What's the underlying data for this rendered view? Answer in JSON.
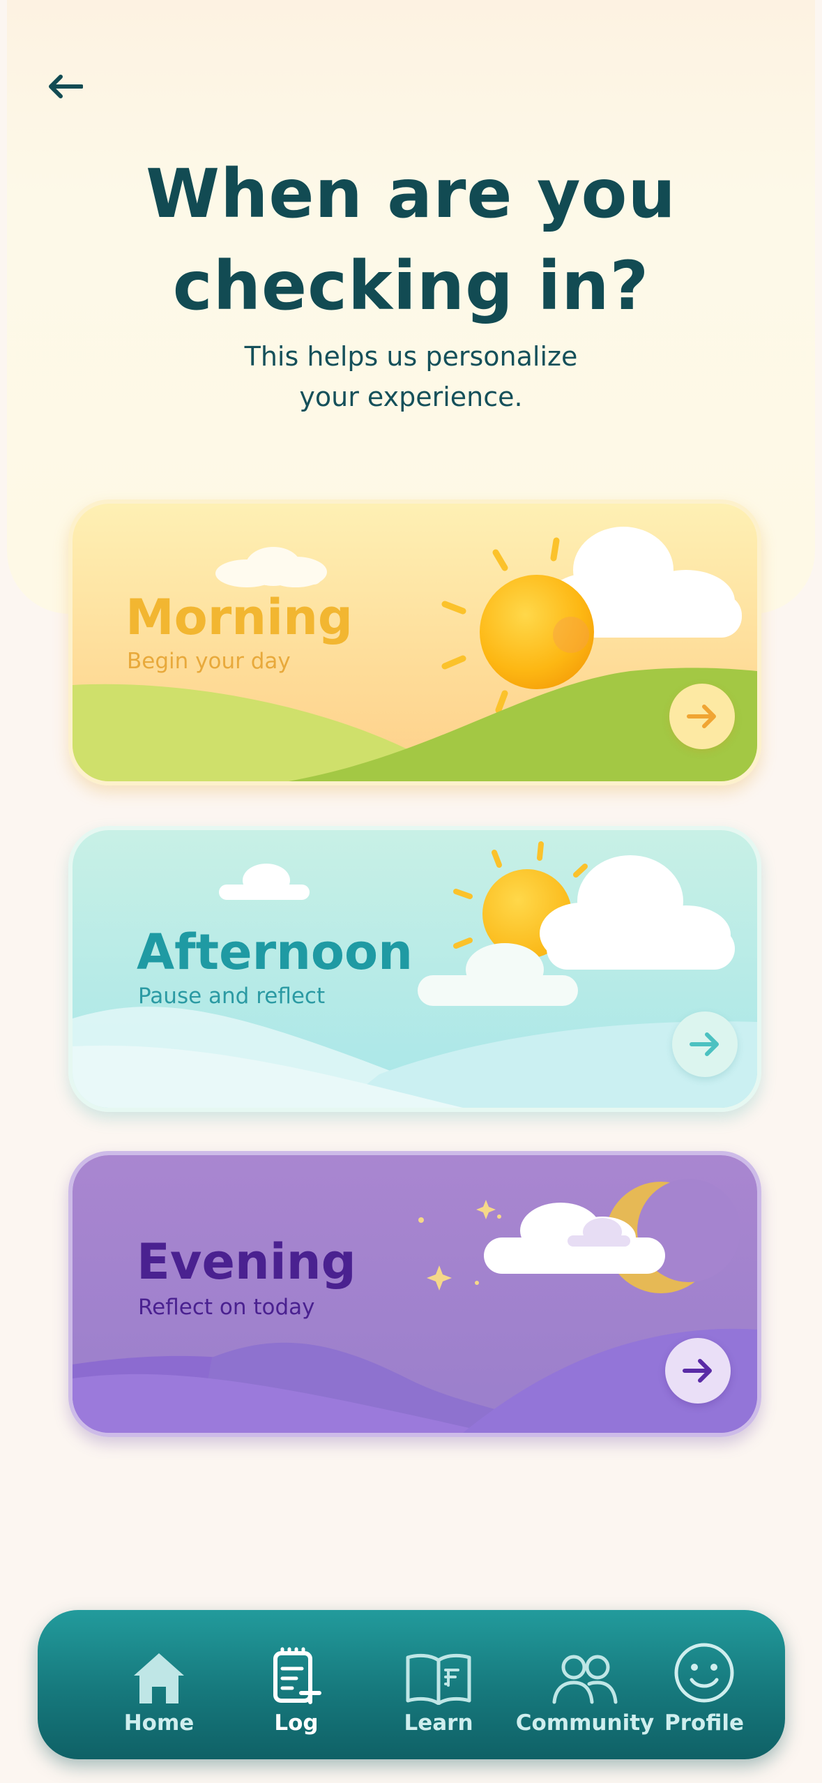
{
  "header": {
    "title_line1": "When are you",
    "title_line2": "checking in?",
    "subtitle_line1": "This helps us personalize",
    "subtitle_line2": "your experience."
  },
  "cards": [
    {
      "label": "Morning",
      "subtitle": "Begin your day"
    },
    {
      "label": "Afternoon",
      "subtitle": "Pause and reflect"
    },
    {
      "label": "Evening",
      "subtitle": "Reflect on today"
    }
  ],
  "nav": {
    "items": [
      {
        "label": "Home",
        "icon": "home-icon"
      },
      {
        "label": "Log",
        "icon": "clipboard-add-icon"
      },
      {
        "label": "Learn",
        "icon": "book-icon"
      },
      {
        "label": "Community",
        "icon": "people-icon"
      },
      {
        "label": "Profile",
        "icon": "smiley-icon"
      }
    ],
    "active": "Log"
  },
  "colors": {
    "primary": "#124b53",
    "nav_bg": "#1b8a8c",
    "morning_text": "#f2b631",
    "afternoon_text": "#1f9aa3",
    "evening_text": "#4a2190"
  }
}
